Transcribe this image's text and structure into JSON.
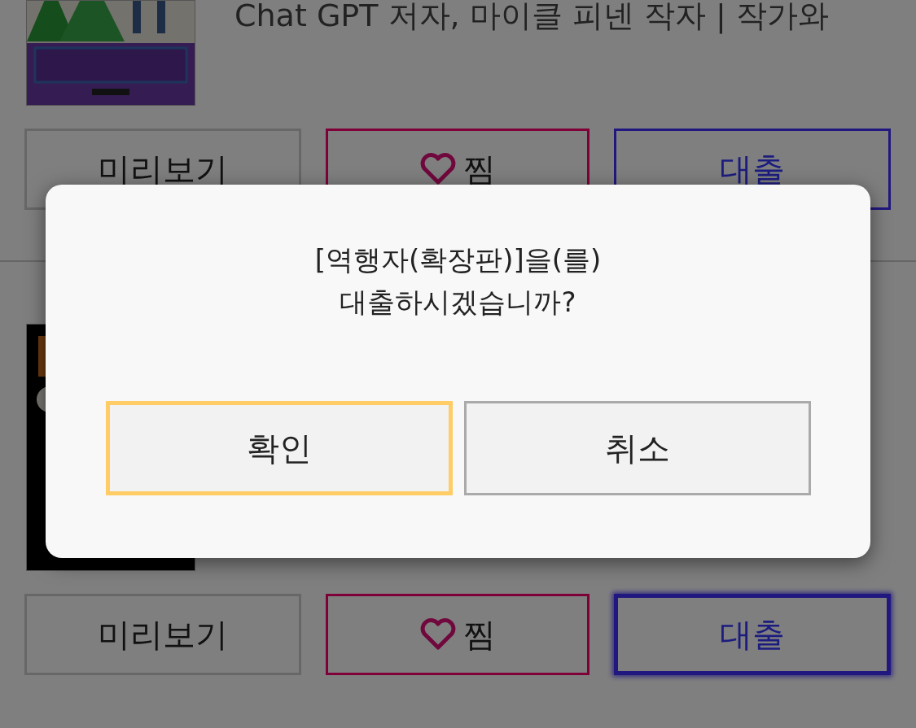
{
  "book_list": [
    {
      "author_line": "Chat GPT 저자, 마이클 피넨 작자 | 작가와",
      "buttons": [
        {
          "kind": "preview",
          "label": "미리보기",
          "focused": false
        },
        {
          "kind": "wish",
          "label": "찜",
          "focused": false
        },
        {
          "kind": "loan",
          "label": "대출",
          "focused": false
        }
      ]
    },
    {
      "buttons": [
        {
          "kind": "preview",
          "label": "미리보기",
          "focused": false
        },
        {
          "kind": "wish",
          "label": "찜",
          "focused": false
        },
        {
          "kind": "loan",
          "label": "대출",
          "focused": true
        }
      ]
    }
  ],
  "dialog": {
    "message_lines": [
      "[역행자(확장판)]을(를)",
      "대출하시겠습니까?"
    ],
    "buttons": [
      {
        "label": "확인",
        "selected": true
      },
      {
        "label": "취소",
        "selected": false
      }
    ]
  }
}
